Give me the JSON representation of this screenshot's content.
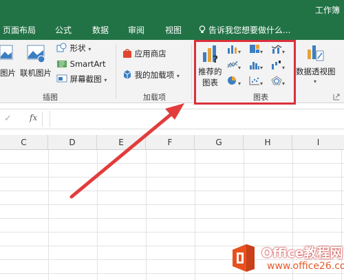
{
  "window": {
    "title": "工作簿"
  },
  "tabs": [
    "页面布局",
    "公式",
    "数据",
    "审阅",
    "视图"
  ],
  "tell_me": "告诉我您想要做什么...",
  "ribbon": {
    "illustrations": {
      "pictures_label": "图片",
      "online_pictures_label": "联机图片",
      "shapes_label": "形状",
      "smartart_label": "SmartArt",
      "screenshot_label": "屏幕截图",
      "group_label": "插图"
    },
    "addins": {
      "store_label": "应用商店",
      "my_addins_label": "我的加载项",
      "group_label": "加载项"
    },
    "charts": {
      "recommended_line1": "推荐的",
      "recommended_line2": "图表",
      "group_label": "图表"
    },
    "pivot": {
      "pivotchart_label": "数据透视图"
    }
  },
  "formula_bar": {
    "fx": "fx",
    "check": "✓"
  },
  "columns": [
    "C",
    "D",
    "E",
    "F",
    "G",
    "H",
    "I"
  ],
  "watermark": {
    "brand": "Office教程网",
    "site": "www.office26.com"
  },
  "colors": {
    "excel_green": "#217346",
    "highlight_red": "#d9303a",
    "arrow_red": "#e23c3c"
  }
}
